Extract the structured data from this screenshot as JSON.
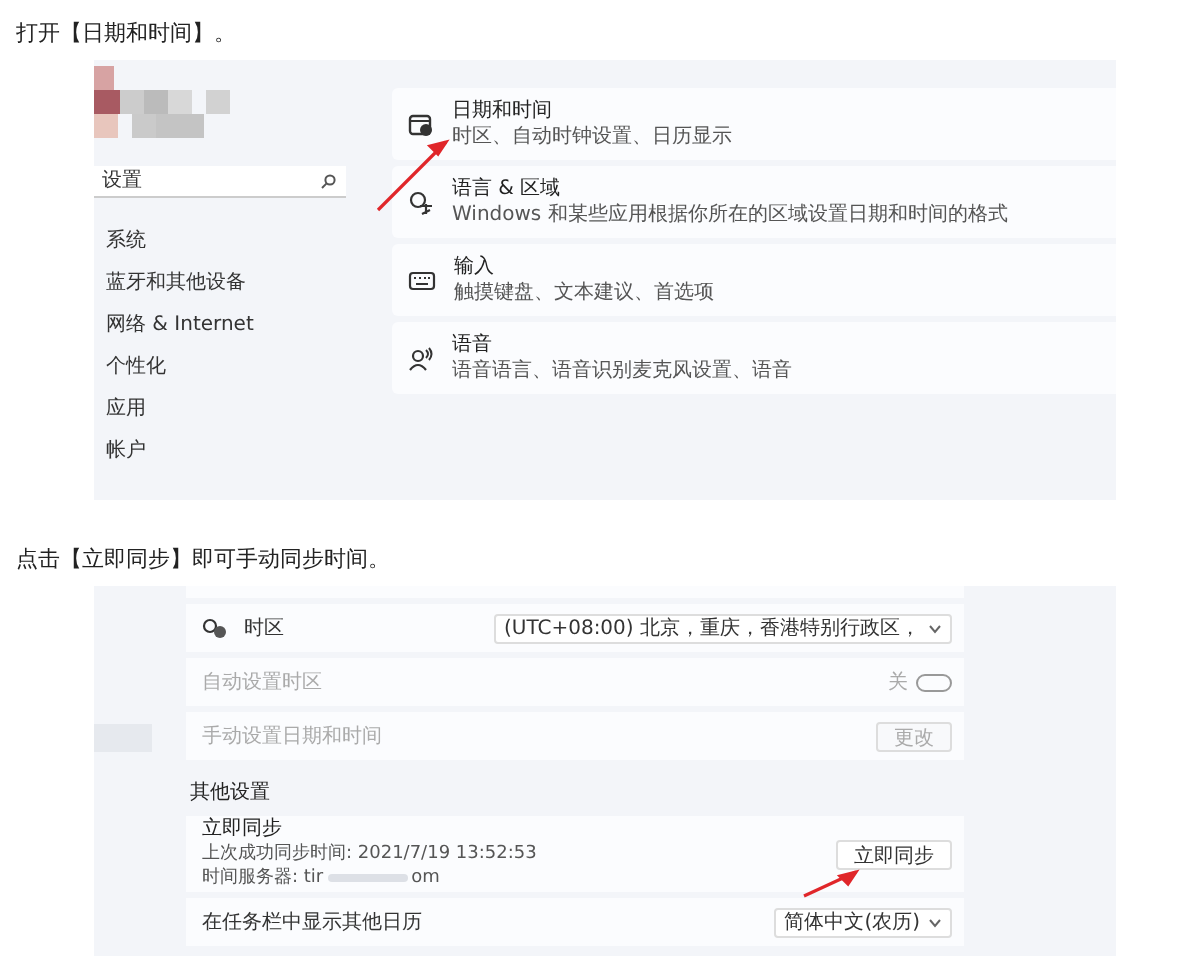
{
  "step_1": {
    "text": "打开【日期和时间】。"
  },
  "screenshot_1": {
    "search": {
      "placeholder": "设置"
    },
    "nav": [
      {
        "label": "系统"
      },
      {
        "label": "蓝牙和其他设备"
      },
      {
        "label": "网络 & Internet"
      },
      {
        "label": "个性化"
      },
      {
        "label": "应用"
      },
      {
        "label": "帐户"
      }
    ],
    "cards": [
      {
        "kind": "calendar",
        "title": "日期和时间",
        "subtitle": "时区、自动时钟设置、日历显示"
      },
      {
        "kind": "language",
        "title": "语言 & 区域",
        "subtitle": "Windows 和某些应用根据你所在的区域设置日期和时间的格式"
      },
      {
        "kind": "keyboard",
        "title": "输入",
        "subtitle": "触摸键盘、文本建议、首选项"
      },
      {
        "kind": "speech",
        "title": "语音",
        "subtitle": "语音语言、语音识别麦克风设置、语音"
      }
    ]
  },
  "step_2": {
    "text": "点击【立即同步】即可手动同步时间。"
  },
  "screenshot_2": {
    "time_zone": {
      "label": "时区",
      "value": "(UTC+08:00) 北京，重庆，香港特别行政区，"
    },
    "auto_time_zone": {
      "label": "自动设置时区",
      "state": "关",
      "on": false,
      "disabled": true
    },
    "manual_time": {
      "label": "手动设置日期和时间",
      "button": "更改",
      "disabled": true
    },
    "section_heading": "其他设置",
    "sync": {
      "title": "立即同步",
      "last_sync": "上次成功同步时间: 2021/7/19 13:52:53",
      "server_prefix": "时间服务器: tir",
      "server_suffix": "om",
      "button": "立即同步"
    },
    "calendar": {
      "label": "在任务栏中显示其他日历",
      "value": "简体中文(农历)"
    }
  }
}
